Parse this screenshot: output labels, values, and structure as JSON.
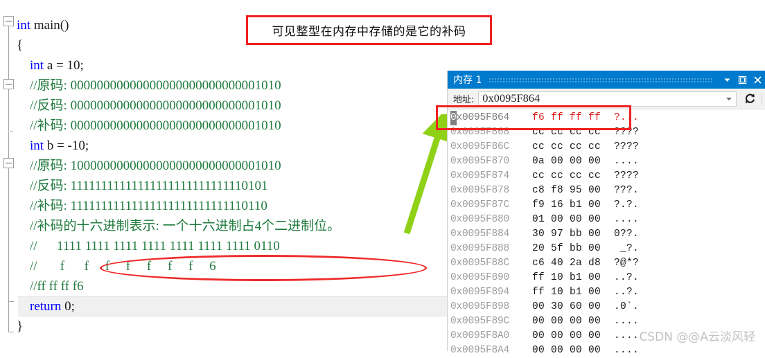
{
  "annotation": {
    "callout_text": "可见整型在内存中存储的是它的补码",
    "callout_color": "#ef2121",
    "ellipse_color": "#ee2b2b",
    "arrow_color": "#8fd117"
  },
  "editor": {
    "lines": [
      {
        "segments": [
          {
            "t": "int ",
            "c": "kw"
          },
          {
            "t": "main()",
            "c": "plain"
          }
        ]
      },
      {
        "segments": [
          {
            "t": "{",
            "c": "plain"
          }
        ]
      },
      {
        "segments": [
          {
            "t": "    int ",
            "c": "kw"
          },
          {
            "t": "a = 10;",
            "c": "plain"
          }
        ]
      },
      {
        "segments": [
          {
            "t": "    //原码: 00000000000000000000000000001010",
            "c": "cmt"
          }
        ]
      },
      {
        "segments": [
          {
            "t": "    //反码: 00000000000000000000000000001010",
            "c": "cmt"
          }
        ]
      },
      {
        "segments": [
          {
            "t": "    //补码: 00000000000000000000000000001010",
            "c": "cmt"
          }
        ]
      },
      {
        "segments": [
          {
            "t": "    int ",
            "c": "kw"
          },
          {
            "t": "b = -10;",
            "c": "plain"
          }
        ]
      },
      {
        "segments": [
          {
            "t": "    //原码: 10000000000000000000000000001010",
            "c": "cmt"
          }
        ]
      },
      {
        "segments": [
          {
            "t": "    //反码: 11111111111111111111111111110101",
            "c": "cmt"
          }
        ]
      },
      {
        "segments": [
          {
            "t": "    //补码: 11111111111111111111111111110110",
            "c": "cmt"
          }
        ]
      },
      {
        "segments": [
          {
            "t": "    //补码的十六进制表示: 一个十六进制占4个二进制位。",
            "c": "cmt"
          }
        ]
      },
      {
        "segments": [
          {
            "t": "    //      1111 1111 1111 1111 1111 1111 1111 0110",
            "c": "cmt"
          }
        ]
      },
      {
        "segments": [
          {
            "t": "    //       f      f     f     f     f     f     f     6",
            "c": "cmt"
          }
        ]
      },
      {
        "segments": [
          {
            "t": "    //ff ff ff f6",
            "c": "cmt"
          }
        ]
      },
      {
        "segments": [
          {
            "t": "    return ",
            "c": "kw"
          },
          {
            "t": "0;",
            "c": "plain"
          }
        ]
      },
      {
        "segments": [
          {
            "t": "}",
            "c": "plain"
          }
        ]
      }
    ],
    "highlighted_line_index": 14
  },
  "memory_window": {
    "title": "内存 1",
    "dropdown_icon": "chevron-down-icon",
    "maximize_icon": "maximize-icon",
    "close_icon": "close-icon",
    "address_label": "地址:",
    "address_value": "0x0095F864",
    "refresh_icon": "refresh-icon",
    "columns": [
      "address",
      "hex",
      "ascii"
    ],
    "rows": [
      {
        "address": "0x0095F864",
        "hex": "f6 ff ff ff",
        "ascii": "?...",
        "highlighted": true
      },
      {
        "address": "0x0095F868",
        "hex": "cc cc cc cc",
        "ascii": "????",
        "highlighted": false
      },
      {
        "address": "0x0095F86C",
        "hex": "cc cc cc cc",
        "ascii": "????",
        "highlighted": false
      },
      {
        "address": "0x0095F870",
        "hex": "0a 00 00 00",
        "ascii": "....",
        "highlighted": false
      },
      {
        "address": "0x0095F874",
        "hex": "cc cc cc cc",
        "ascii": "????",
        "highlighted": false
      },
      {
        "address": "0x0095F878",
        "hex": "c8 f8 95 00",
        "ascii": "???.",
        "highlighted": false
      },
      {
        "address": "0x0095F87C",
        "hex": "f9 16 b1 00",
        "ascii": "?.?.",
        "highlighted": false
      },
      {
        "address": "0x0095F880",
        "hex": "01 00 00 00",
        "ascii": "....",
        "highlighted": false
      },
      {
        "address": "0x0095F884",
        "hex": "30 97 bb 00",
        "ascii": "0??.",
        "highlighted": false
      },
      {
        "address": "0x0095F888",
        "hex": "20 5f bb 00",
        "ascii": " _?.",
        "highlighted": false
      },
      {
        "address": "0x0095F88C",
        "hex": "c6 40 2a d8",
        "ascii": "?@*?",
        "highlighted": false
      },
      {
        "address": "0x0095F890",
        "hex": "ff 10 b1 00",
        "ascii": "..?.",
        "highlighted": false
      },
      {
        "address": "0x0095F894",
        "hex": "ff 10 b1 00",
        "ascii": "..?.",
        "highlighted": false
      },
      {
        "address": "0x0095F898",
        "hex": "00 30 60 00",
        "ascii": ".0`.",
        "highlighted": false
      },
      {
        "address": "0x0095F89C",
        "hex": "00 00 00 00",
        "ascii": "....",
        "highlighted": false
      },
      {
        "address": "0x0095F8A0",
        "hex": "00 00 00 00",
        "ascii": "....",
        "highlighted": false
      },
      {
        "address": "0x0095F8A4",
        "hex": "00 00 00 00",
        "ascii": "....",
        "highlighted": false
      }
    ]
  },
  "watermark": {
    "text": "CSDN @@A云淡风轻"
  }
}
